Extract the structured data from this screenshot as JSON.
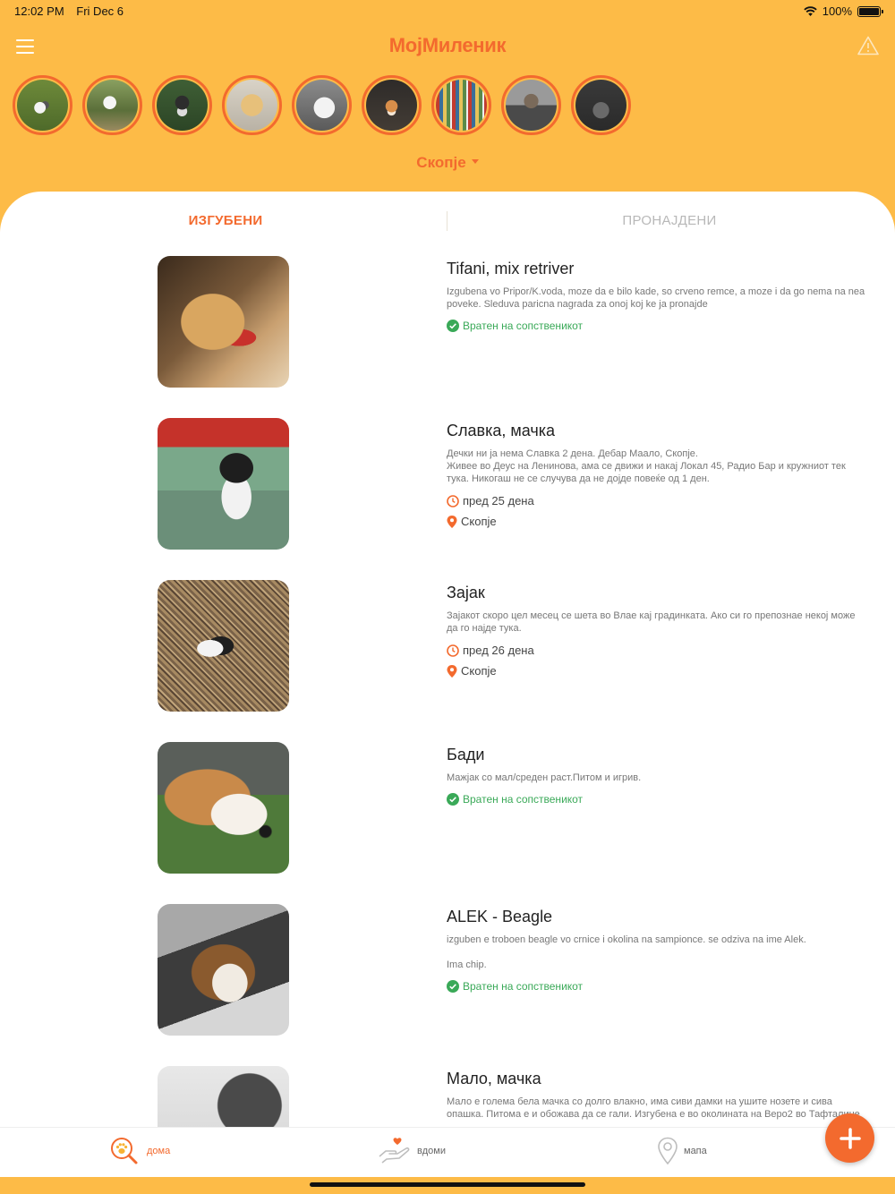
{
  "status_bar": {
    "time": "12:02 PM",
    "date": "Fri Dec 6",
    "battery": "100%"
  },
  "header": {
    "title": "МојМиленик",
    "menu_icon": "hamburger-icon",
    "alert_icon": "warning-icon"
  },
  "city_selector": {
    "label": "Скопје"
  },
  "tabs": {
    "lost": "ИЗГУБЕНИ",
    "found": "ПРОНАЈДЕНИ"
  },
  "pets": [
    {
      "name": "Tifani, mix retriver",
      "description": "Izgubena vo Pripor/K.voda, moze da e bilo kade, so crveno remce, a moze i da go nema na nea poveke. Sleduva paricna nagrada za onoj koj ke ja pronajde",
      "status": "Вратен на сопственикот"
    },
    {
      "name": "Славка, мачка",
      "description": "Дечки ни ја нема Славка 2 дена. Дебар Маало, Скопје.\nЖивее во Деус на Ленинова, ама се движи и накај Локал 45, Радио Бар и кружниот тек тука. Никогаш не се случува да не дојде повеќе од 1 ден.",
      "time": "пред 25 дена",
      "location": "Скопје"
    },
    {
      "name": "Зајак",
      "description": "Зајакот скоро цел месец се шета во Влае кај градинката. Ако си го препознае некој може да го најде тука.",
      "time": "пред 26 дена",
      "location": "Скопје"
    },
    {
      "name": "Бади",
      "description": "Мажјак со мал/среден раст.Питом и игрив.",
      "status": "Вратен на сопственикот"
    },
    {
      "name": "ALEK - Beagle",
      "description": "izguben e troboen beagle vo crnice i okolina na sampionce. se odziva na ime Alek.\n\nIma chip.",
      "status": "Вратен на сопственикот"
    },
    {
      "name": "Мало, мачка",
      "description": "Мало е голема бела мачка со долго влакно, има сиви дамки на ушите нозете и сива опашка. Питома е и обожава да се гали. Изгубена е во околината на Веро2 во Тафталиџе"
    }
  ],
  "bottom_nav": {
    "home": "дома",
    "adopt": "вдоми",
    "map": "мапа"
  },
  "colors": {
    "primary": "#f36a2e",
    "background": "#fdbb47",
    "success": "#3aa958"
  }
}
